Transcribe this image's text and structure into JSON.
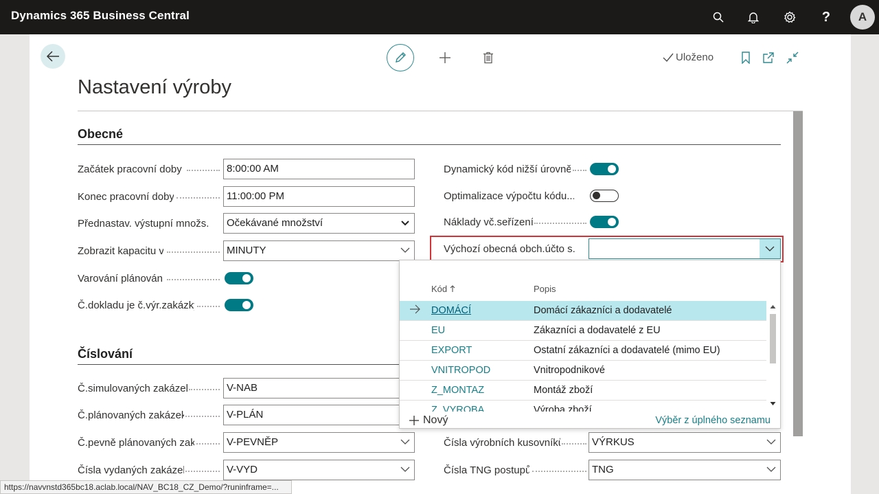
{
  "app": {
    "title": "Dynamics 365 Business Central",
    "user_initial": "A"
  },
  "topbar_icons": [
    "search-icon",
    "bell-icon",
    "gear-icon",
    "help-icon"
  ],
  "actions": {
    "saved_label": "Uloženo",
    "help_glyph": "?"
  },
  "page": {
    "title": "Nastavení výroby"
  },
  "general": {
    "heading": "Obecné",
    "work_start_label": "Začátek pracovní doby",
    "work_start_value": "8:00:00 AM",
    "work_end_label": "Konec pracovní doby",
    "work_end_value": "11:00:00 PM",
    "preset_output_label": "Přednastav. výstupní množs...",
    "preset_output_value": "Očekávané množství",
    "show_capacity_label": "Zobrazit kapacitu v",
    "show_capacity_value": "MINUTY",
    "planning_warning_label": "Varování plánování",
    "planning_warning_on": true,
    "doc_no_is_prod_order_label": "Č.dokladu je č.výr.zakázky",
    "doc_no_is_prod_order_on": true,
    "dynamic_low_level_label": "Dynamický kód nižší úrovně",
    "dynamic_low_level_on": true,
    "optimize_calc_label": "Optimalizace výpočtu kódu...",
    "optimize_calc_on": false,
    "setup_cost_label": "Náklady vč.seřízení",
    "setup_cost_on": true,
    "default_gen_bus_label": "Výchozí obecná obch.účto s...",
    "default_gen_bus_value": ""
  },
  "lookup": {
    "col_code": "Kód",
    "col_desc": "Popis",
    "rows": [
      {
        "code": "DOMÁCÍ",
        "desc": "Domácí zákazníci a dodavatelé",
        "selected": true
      },
      {
        "code": "EU",
        "desc": "Zákazníci a dodavatelé z EU",
        "selected": false
      },
      {
        "code": "EXPORT",
        "desc": "Ostatní zákazníci a dodavatelé (mimo EU)",
        "selected": false
      },
      {
        "code": "VNITROPOD",
        "desc": "Vnitropodnikové",
        "selected": false
      },
      {
        "code": "Z_MONTAZ",
        "desc": "Montáž zboží",
        "selected": false
      },
      {
        "code": "Z_VYROBA",
        "desc": "Výroba zboží",
        "selected": false
      }
    ],
    "new_label": "Nový",
    "full_list_label": "Výběr z úplného seznamu"
  },
  "numbering": {
    "heading": "Číslování",
    "simulated_label": "Č.simulovaných zakázek",
    "simulated_value": "V-NAB",
    "planned_label": "Č.plánovaných zakázek",
    "planned_value": "V-PLÁN",
    "firm_planned_label": "Č.pevně plánovaných zak.",
    "firm_planned_value": "V-PEVNĚP",
    "released_label": "Čísla vydaných zakázek",
    "released_value": "V-VYD",
    "bom_label": "Čísla výrobních kusovníků",
    "bom_value": "VÝRKUS",
    "routing_label": "Čísla TNG postupů",
    "routing_value": "TNG"
  },
  "status_bar": {
    "url": "https://navvnstd365bc18.aclab.local/NAV_BC18_CZ_Demo/?runinframe=..."
  }
}
